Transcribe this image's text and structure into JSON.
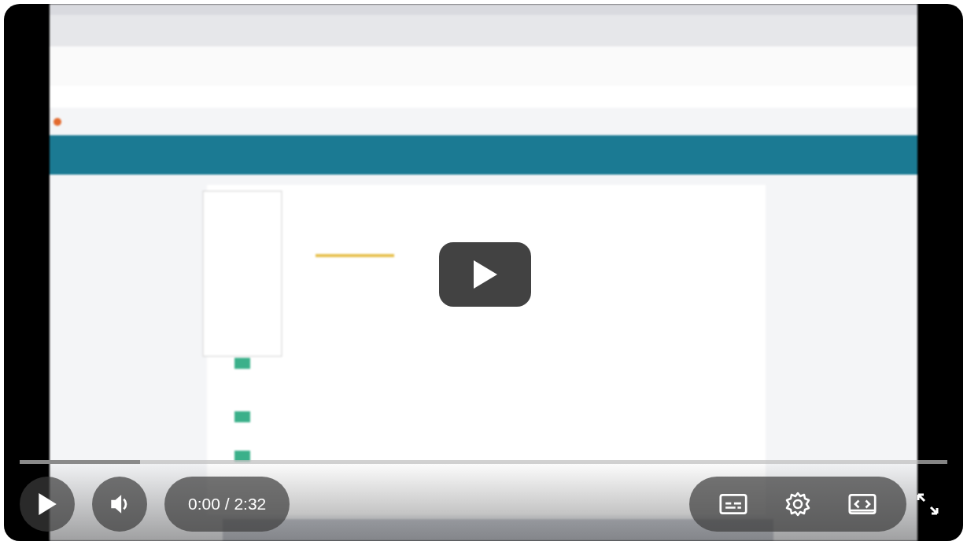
{
  "player": {
    "progress": {
      "level": 0.13
    },
    "time": "0:00 / 2:32"
  }
}
